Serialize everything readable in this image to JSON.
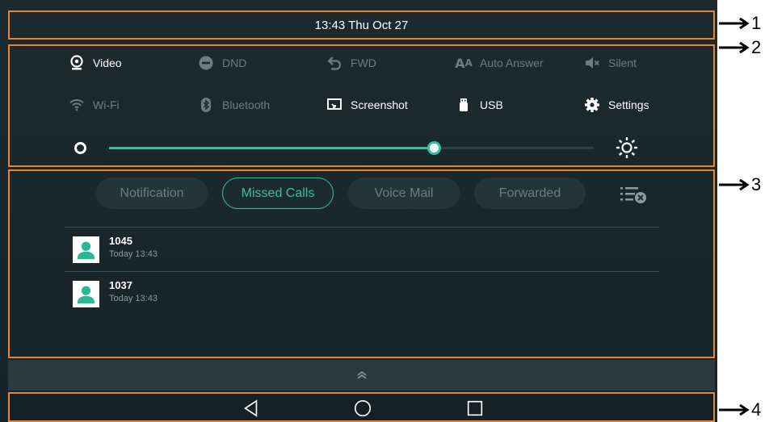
{
  "status_bar": {
    "time": "13:43 Thu Oct 27"
  },
  "quick_settings": {
    "row1": [
      {
        "label": "Video",
        "icon": "video-icon",
        "enabled": true
      },
      {
        "label": "DND",
        "icon": "dnd-icon",
        "enabled": false
      },
      {
        "label": "FWD",
        "icon": "forward-icon",
        "enabled": false
      },
      {
        "label": "Auto Answer",
        "icon": "auto-answer-icon",
        "enabled": false
      },
      {
        "label": "Silent",
        "icon": "silent-icon",
        "enabled": false
      }
    ],
    "row2": [
      {
        "label": "Wi-Fi",
        "icon": "wifi-icon",
        "enabled": false
      },
      {
        "label": "Bluetooth",
        "icon": "bluetooth-icon",
        "enabled": false
      },
      {
        "label": "Screenshot",
        "icon": "screenshot-icon",
        "enabled": true
      },
      {
        "label": "USB",
        "icon": "usb-icon",
        "enabled": true
      },
      {
        "label": "Settings",
        "icon": "gear-icon",
        "enabled": true
      }
    ],
    "brightness": {
      "level": 0.67
    }
  },
  "tabs": [
    {
      "label": "Notification",
      "active": false
    },
    {
      "label": "Missed Calls",
      "active": true
    },
    {
      "label": "Voice Mail",
      "active": false
    },
    {
      "label": "Forwarded",
      "active": false
    }
  ],
  "missed_calls": [
    {
      "number": "1045",
      "time": "Today 13:43"
    },
    {
      "number": "1037",
      "time": "Today 13:43"
    }
  ],
  "callouts": [
    "1",
    "2",
    "3",
    "4"
  ],
  "colors": {
    "accent": "#3bbf9c",
    "frame": "#e8872a",
    "background": "#1b2a30",
    "disabled": "#6f7c82"
  }
}
